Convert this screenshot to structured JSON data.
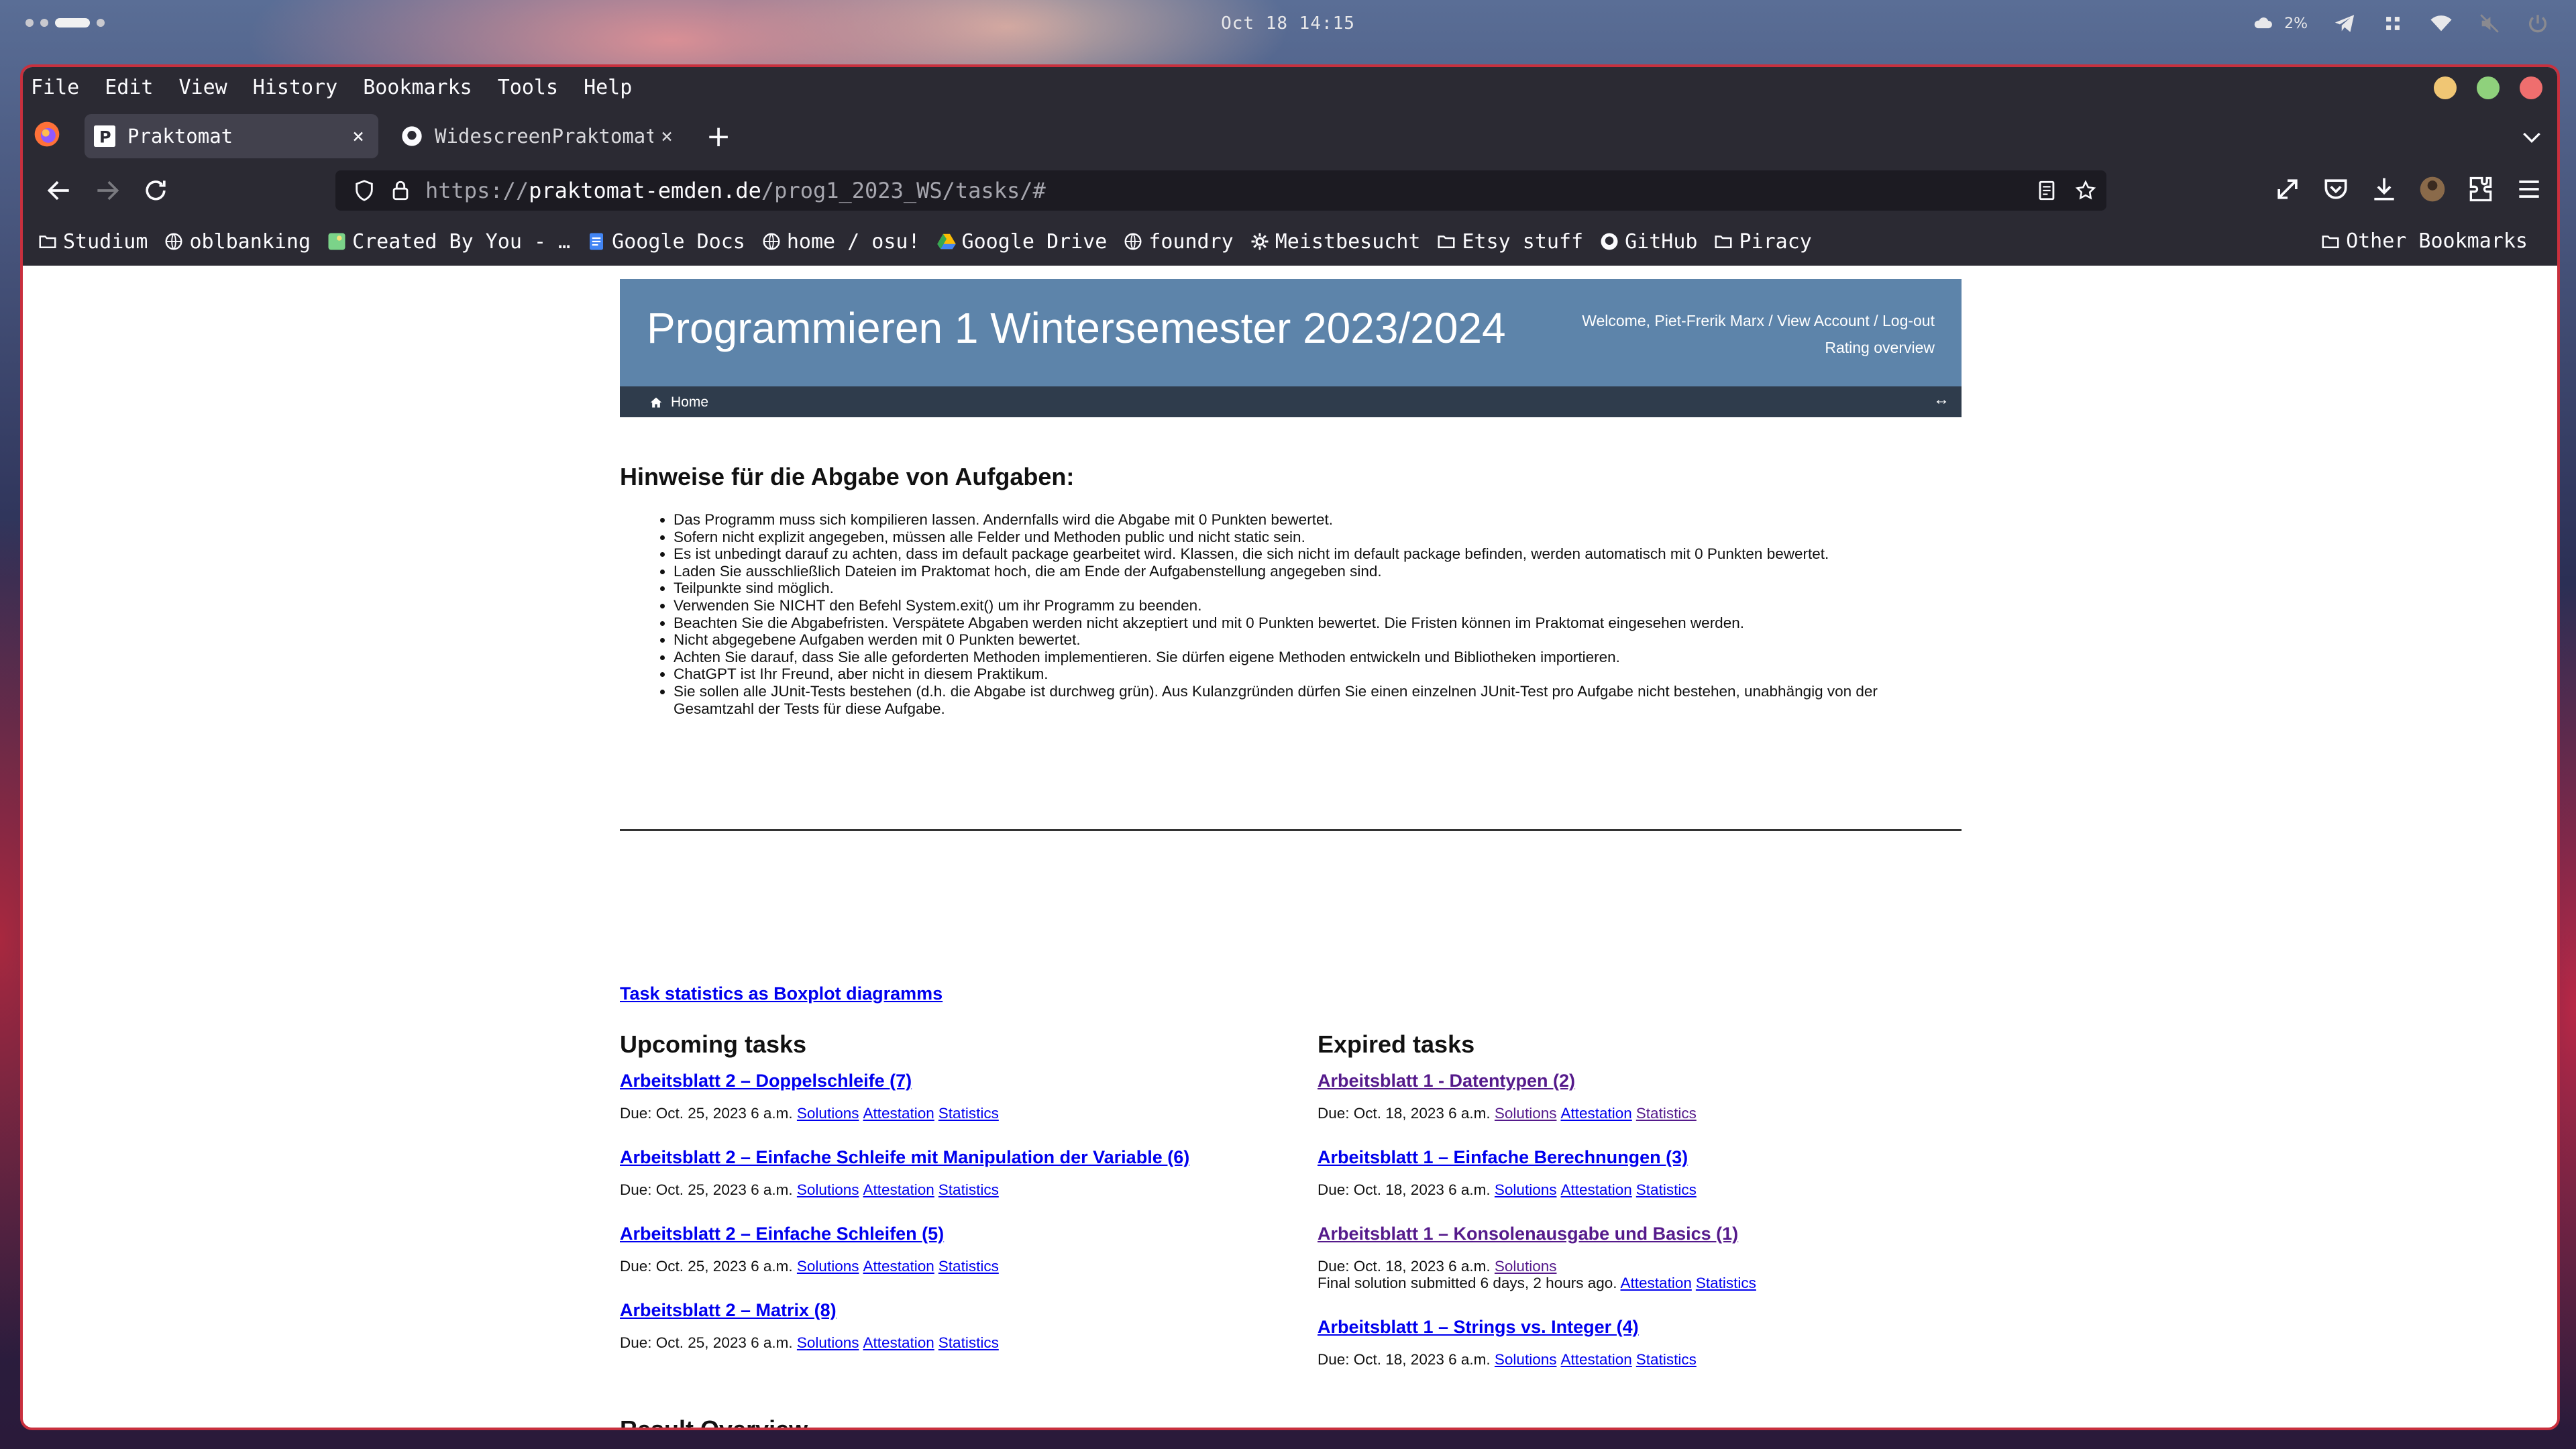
{
  "system": {
    "clock": "Oct 18 14:15",
    "weather_temp": "2%"
  },
  "menu": [
    "File",
    "Edit",
    "View",
    "History",
    "Bookmarks",
    "Tools",
    "Help"
  ],
  "tabs": [
    {
      "title": "Praktomat",
      "active": true
    },
    {
      "title": "WidescreenPraktomat",
      "active": false
    }
  ],
  "url": {
    "scheme": "https://",
    "host": "praktomat-emden.de",
    "path": "/prog1_2023_WS/tasks/#"
  },
  "bookmarks": [
    {
      "label": "Studium",
      "icon": "folder-icon"
    },
    {
      "label": "oblbanking",
      "icon": "globe-icon"
    },
    {
      "label": "Created By You - …",
      "icon": "image-icon"
    },
    {
      "label": "Google Docs",
      "icon": "docs-icon"
    },
    {
      "label": "home / osu!",
      "icon": "globe-icon"
    },
    {
      "label": "Google Drive",
      "icon": "drive-icon"
    },
    {
      "label": "foundry",
      "icon": "globe-icon"
    },
    {
      "label": "Meistbesucht",
      "icon": "gear-icon"
    },
    {
      "label": "Etsy stuff",
      "icon": "folder-icon"
    },
    {
      "label": "GitHub",
      "icon": "github-icon"
    },
    {
      "label": "Piracy",
      "icon": "folder-icon"
    }
  ],
  "other_bookmarks": "Other Bookmarks",
  "site": {
    "title": "Programmieren 1 Wintersemester 2023/2024",
    "welcome": "Welcome, Piet-Frerik Marx",
    "view_account": "View Account",
    "logout": "Log-out",
    "sep": " / ",
    "rating": "Rating overview",
    "nav_home": "Home",
    "nav_toggle": "↔"
  },
  "hints": {
    "heading": "Hinweise für die Abgabe von Aufgaben:",
    "items": [
      "Das Programm muss sich kompilieren lassen. Andernfalls wird die Abgabe mit 0 Punkten bewertet.",
      "Sofern nicht explizit angegeben, müssen alle Felder und Methoden public und nicht static sein.",
      "Es ist unbedingt darauf zu achten, dass im default package gearbeitet wird. Klassen, die sich nicht im default package befinden, werden automatisch mit 0 Punkten bewertet.",
      "Laden Sie ausschließlich Dateien im Praktomat hoch, die am Ende der Aufgabenstellung angegeben sind.",
      "Teilpunkte sind möglich.",
      "Verwenden Sie NICHT den Befehl System.exit() um ihr Programm zu beenden.",
      "Beachten Sie die Abgabefristen. Verspätete Abgaben werden nicht akzeptiert und mit 0 Punkten bewertet. Die Fristen können im Praktomat eingesehen werden.",
      "Nicht abgegebene Aufgaben werden mit 0 Punkten bewertet.",
      "Achten Sie darauf, dass Sie alle geforderten Methoden implementieren. Sie dürfen eigene Methoden entwickeln und Bibliotheken importieren.",
      "ChatGPT ist Ihr Freund, aber nicht in diesem Praktikum.",
      "Sie sollen alle JUnit-Tests bestehen (d.h. die Abgabe ist durchweg grün). Aus Kulanzgründen dürfen Sie einen einzelnen JUnit-Test pro Aufgabe nicht bestehen, unabhängig von der Gesamtzahl der Tests für diese Aufgabe."
    ]
  },
  "boxplot_link": "Task statistics as Boxplot diagramms",
  "labels": {
    "solutions": "Solutions",
    "attestation": "Attestation",
    "statistics": "Statistics"
  },
  "upcoming": {
    "heading": "Upcoming tasks",
    "tasks": [
      {
        "name": "Arbeitsblatt 2 – Doppelschleife (7)",
        "due": "Due: Oct. 25, 2023 6 a.m."
      },
      {
        "name": "Arbeitsblatt 2 – Einfache Schleife mit Manipulation der Variable (6)",
        "due": "Due: Oct. 25, 2023 6 a.m."
      },
      {
        "name": "Arbeitsblatt 2 – Einfache Schleifen (5)",
        "due": "Due: Oct. 25, 2023 6 a.m."
      },
      {
        "name": "Arbeitsblatt 2 – Matrix (8)",
        "due": "Due: Oct. 25, 2023 6 a.m."
      }
    ]
  },
  "expired": {
    "heading": "Expired tasks",
    "tasks": [
      {
        "name": "Arbeitsblatt 1 - Datentypen (2)",
        "due": "Due: Oct. 18, 2023 6 a.m."
      },
      {
        "name": "Arbeitsblatt 1 – Einfache Berechnungen (3)",
        "due": "Due: Oct. 18, 2023 6 a.m."
      },
      {
        "name": "Arbeitsblatt 1 – Konsolenausgabe und Basics (1)",
        "due": "Due: Oct. 18, 2023 6 a.m.",
        "note": "Final solution submitted 6 days, 2 hours ago."
      },
      {
        "name": "Arbeitsblatt 1 – Strings vs. Integer (4)",
        "due": "Due: Oct. 18, 2023 6 a.m."
      }
    ]
  },
  "result_overview": "Result Overview",
  "colors": {
    "header_blue": "#5d84aa",
    "nav_dark": "#2f3c4c",
    "browser_chrome": "#2b2a33",
    "window_border": "#c8303e",
    "link": "#0000ee",
    "visited_link": "#551a8b"
  }
}
